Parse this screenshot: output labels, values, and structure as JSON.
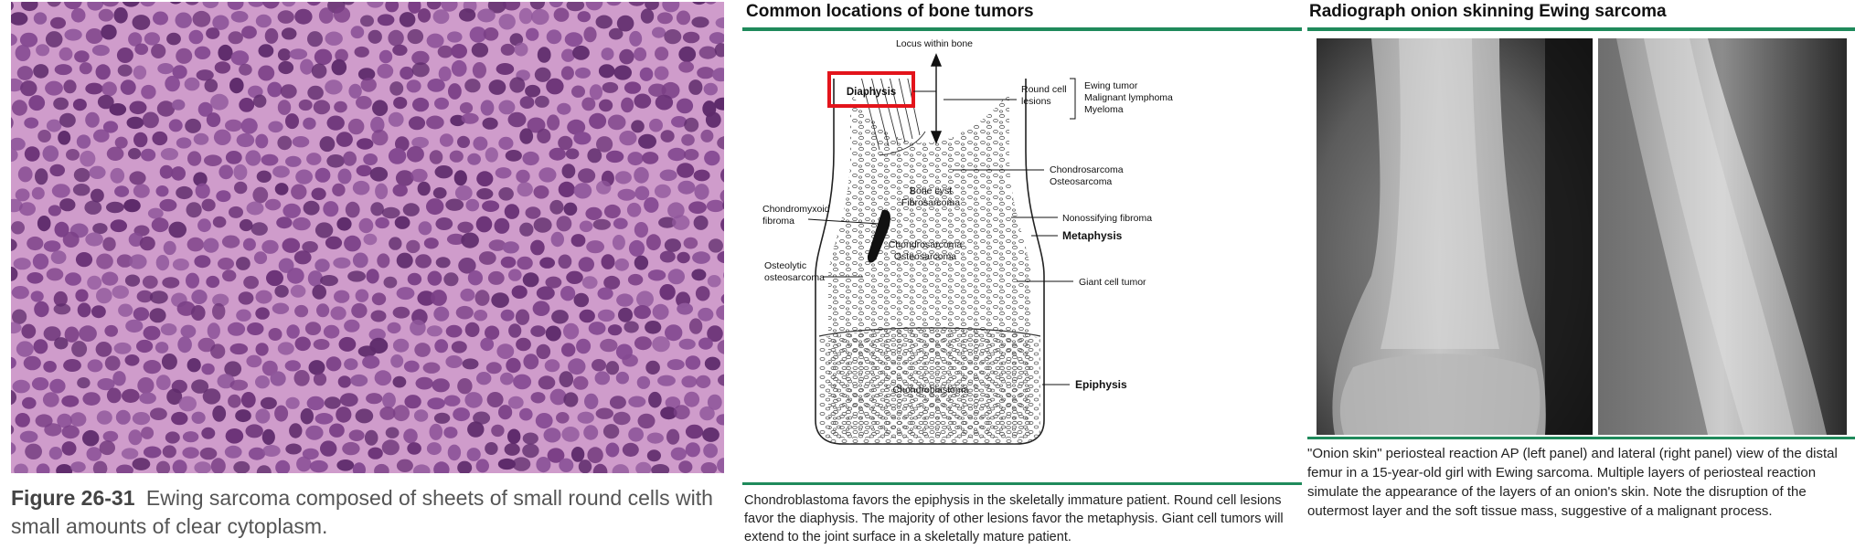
{
  "histology": {
    "figure_label": "Figure 26-31",
    "caption": "Ewing sarcoma composed of sheets of small round cells with small amounts of clear cytoplasm."
  },
  "bone_panel": {
    "title": "Common locations of bone tumors",
    "caption": "Chondroblastoma favors the epiphysis in the skeletally immature patient. Round cell lesions favor the diaphysis. The majority of other lesions favor the metaphysis. Giant cell tumors will extend to the joint surface in a skeletally mature patient.",
    "labels": {
      "locus": "Locus within bone",
      "diaphysis": "Diaphysis",
      "round_cell_1": "Round cell",
      "round_cell_2": "lesions",
      "ewing": "Ewing tumor",
      "lymphoma": "Malignant lymphoma",
      "myeloma": "Myeloma",
      "chondrosarcoma_top": "Chondrosarcoma",
      "osteosarcoma_top": "Osteosarcoma",
      "bone_cyst": "Bone cyst",
      "fibrosarcoma": "Fibrosarcoma",
      "chondromyxoid_1": "Chondromyxoid",
      "chondromyxoid_2": "fibroma",
      "nonossifying": "Nonossifying fibroma",
      "metaphysis": "Metaphysis",
      "chondrosarcoma_mid": "Chondrosarcoma",
      "osteosarcoma_mid": "Osteosarcoma",
      "osteolytic_1": "Osteolytic",
      "osteolytic_2": "osteosarcoma",
      "giant_cell": "Giant cell tumor",
      "chondroblastoma": "Chondroblastoma",
      "epiphysis": "Epiphysis"
    },
    "colors": {
      "highlight": "#e3141b",
      "rule": "#1f8a5b"
    }
  },
  "xray_panel": {
    "title": "Radiograph onion skinning Ewing sarcoma",
    "caption": "\"Onion skin\" periosteal reaction AP (left panel) and lateral (right panel) view of the distal femur in a 15-year-old girl with Ewing sarcoma. Multiple layers of periosteal reaction simulate the appearance of the layers of an onion's skin. Note the disruption of the outermost layer and the soft tissue mass, suggestive of a malignant process."
  }
}
